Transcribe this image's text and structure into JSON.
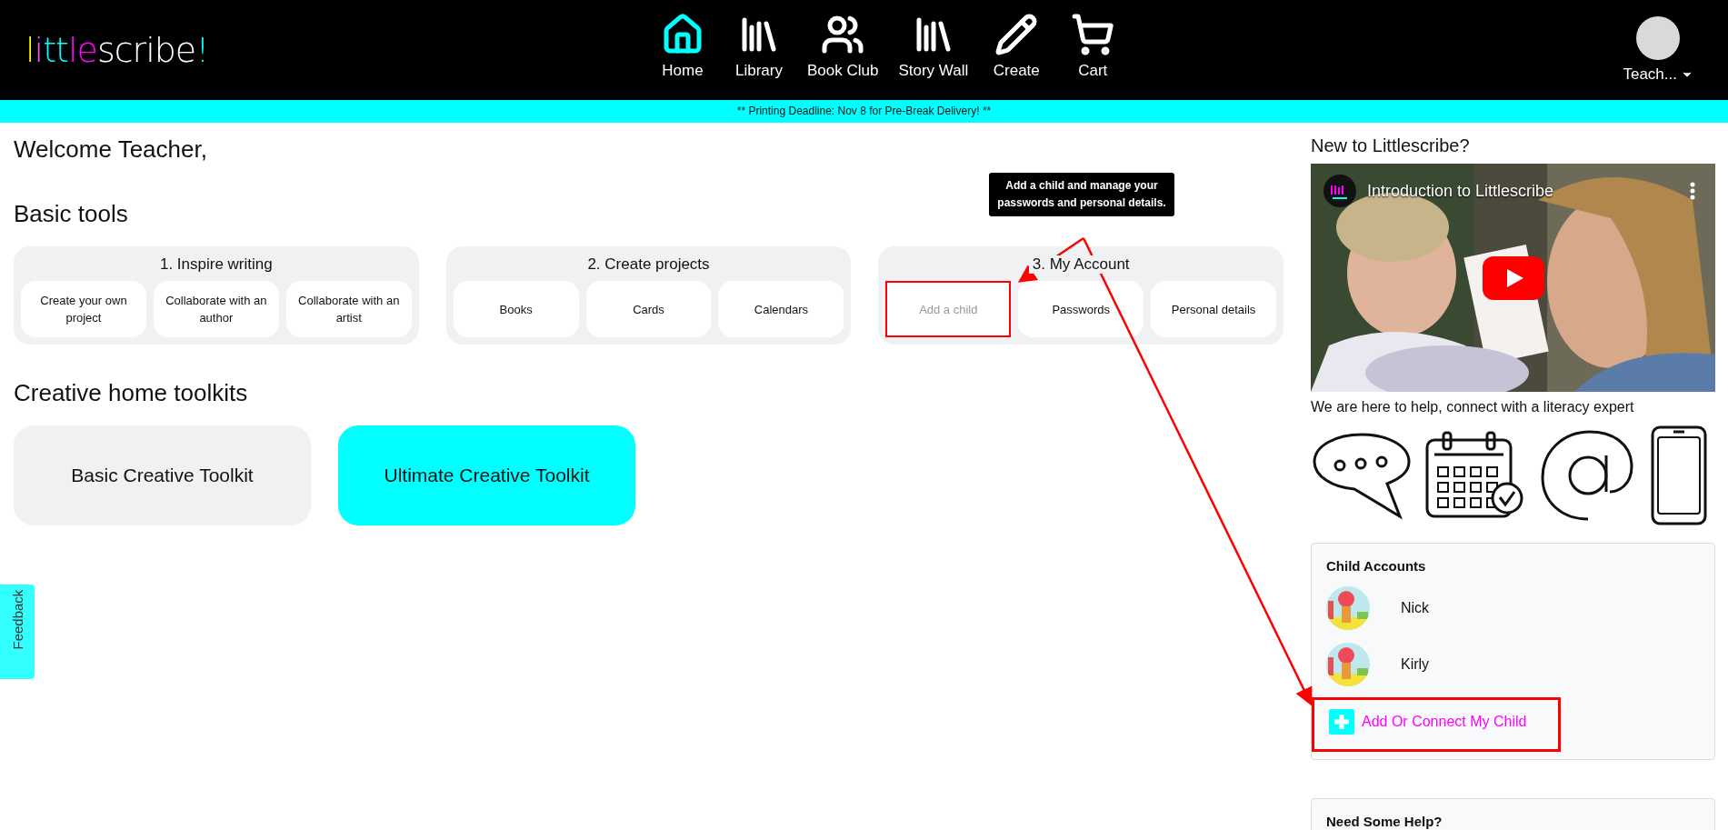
{
  "header": {
    "logo": [
      {
        "text": "l",
        "color": "#ffff00"
      },
      {
        "text": "i",
        "color": "#ff4df0"
      },
      {
        "text": "tt",
        "color": "#00ffff"
      },
      {
        "text": "le",
        "color": "#ff00ff"
      },
      {
        "text": "scribe",
        "color": "#ffffff"
      },
      {
        "text": "!",
        "color": "#00ffff"
      }
    ],
    "nav": [
      {
        "label": "Home",
        "selected": true
      },
      {
        "label": "Library",
        "selected": false
      },
      {
        "label": "Book Club",
        "selected": false
      },
      {
        "label": "Story Wall",
        "selected": false
      },
      {
        "label": "Create",
        "selected": false
      },
      {
        "label": "Cart",
        "selected": false
      }
    ],
    "user": {
      "name": "Teach..."
    }
  },
  "banner": "** Printing Deadline: Nov 8 for Pre-Break Delivery! **",
  "welcome": "Welcome Teacher,",
  "basic_tools": {
    "title": "Basic tools",
    "groups": [
      {
        "title": "1. Inspire writing",
        "items": [
          {
            "label": "Create your own project",
            "highlighted": false,
            "disabled": false
          },
          {
            "label": "Collaborate with an author",
            "highlighted": false,
            "disabled": false
          },
          {
            "label": "Collaborate with an artist",
            "highlighted": false,
            "disabled": false
          }
        ]
      },
      {
        "title": "2. Create projects",
        "items": [
          {
            "label": "Books",
            "highlighted": false,
            "disabled": false
          },
          {
            "label": "Cards",
            "highlighted": false,
            "disabled": false
          },
          {
            "label": "Calendars",
            "highlighted": false,
            "disabled": false
          }
        ]
      },
      {
        "title": "3. My Account",
        "items": [
          {
            "label": "Add a child",
            "highlighted": true,
            "disabled": true
          },
          {
            "label": "Passwords",
            "highlighted": false,
            "disabled": false
          },
          {
            "label": "Personal details",
            "highlighted": false,
            "disabled": false
          }
        ]
      }
    ]
  },
  "tooltip": "Add a child and manage your passwords and personal details.",
  "toolkits": {
    "title": "Creative home toolkits",
    "items": [
      {
        "label": "Basic Creative Toolkit",
        "selected": false
      },
      {
        "label": "Ultimate Creative Toolkit",
        "selected": true
      }
    ]
  },
  "feedback": "Feedback",
  "sidebar": {
    "intro_title": "New to Littlescribe?",
    "video": {
      "title": "Introduction to Littlescribe"
    },
    "help_text": "We are here to help, connect with a literacy expert",
    "child_accounts": {
      "title": "Child Accounts",
      "children": [
        {
          "name": "Nick"
        },
        {
          "name": "Kirly"
        }
      ],
      "add": {
        "label": "Add Or Connect My Child",
        "highlighted": true
      }
    },
    "help_card": {
      "title": "Need Some Help?"
    }
  }
}
